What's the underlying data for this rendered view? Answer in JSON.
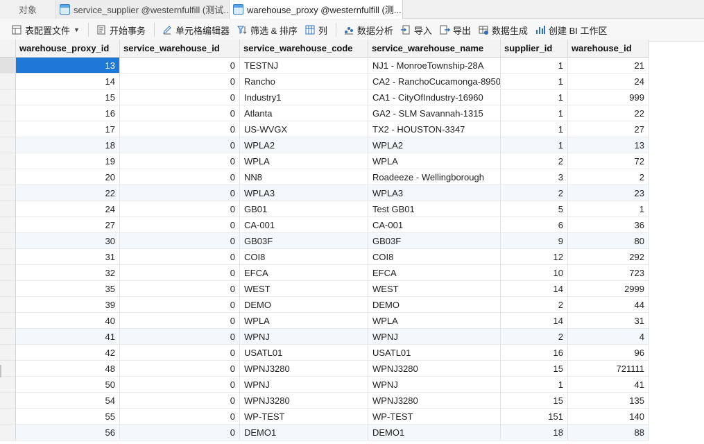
{
  "tabs": {
    "objects_label": "对象",
    "items": [
      {
        "label": "service_supplier @westernfulfill (测试..."
      },
      {
        "label": "warehouse_proxy @westernfulfill (测..."
      }
    ]
  },
  "toolbar": {
    "items": [
      {
        "label": "表配置文件",
        "icon": "table-config-icon"
      },
      {
        "label": "开始事务",
        "icon": "transaction-icon"
      },
      {
        "label": "单元格编辑器",
        "icon": "pencil-icon"
      },
      {
        "label": "筛选 & 排序",
        "icon": "filter-sort-icon"
      },
      {
        "label": "列",
        "icon": "columns-icon"
      },
      {
        "label": "数据分析",
        "icon": "data-analysis-icon"
      },
      {
        "label": "导入",
        "icon": "import-icon"
      },
      {
        "label": "导出",
        "icon": "export-icon"
      },
      {
        "label": "数据生成",
        "icon": "data-generate-icon"
      },
      {
        "label": "创建 BI 工作区",
        "icon": "bi-workspace-icon"
      }
    ]
  },
  "grid": {
    "columns": [
      "warehouse_proxy_id",
      "service_warehouse_id",
      "service_warehouse_code",
      "service_warehouse_name",
      "supplier_id",
      "warehouse_id"
    ],
    "rows": [
      [
        "13",
        "0",
        "TESTNJ",
        "NJ1 - MonroeTownship-28A",
        "1",
        "21"
      ],
      [
        "14",
        "0",
        "Rancho",
        "CA2 - RanchoCucamonga-8950",
        "1",
        "24"
      ],
      [
        "15",
        "0",
        "Industry1",
        "CA1 - CityOfIndustry-16960",
        "1",
        "999"
      ],
      [
        "16",
        "0",
        "Atlanta",
        "GA2 - SLM Savannah-1315",
        "1",
        "22"
      ],
      [
        "17",
        "0",
        "US-WVGX",
        "TX2 - HOUSTON-3347",
        "1",
        "27"
      ],
      [
        "18",
        "0",
        "WPLA2",
        "WPLA2",
        "1",
        "13"
      ],
      [
        "19",
        "0",
        "WPLA",
        "WPLA",
        "2",
        "72"
      ],
      [
        "20",
        "0",
        "NN8",
        "Roadeeze - Wellingborough",
        "3",
        "2"
      ],
      [
        "22",
        "0",
        "WPLA3",
        "WPLA3",
        "2",
        "23"
      ],
      [
        "24",
        "0",
        "GB01",
        "Test GB01",
        "5",
        "1"
      ],
      [
        "27",
        "0",
        "CA-001",
        "CA-001",
        "6",
        "36"
      ],
      [
        "30",
        "0",
        "GB03F",
        "GB03F",
        "9",
        "80"
      ],
      [
        "31",
        "0",
        "COI8",
        "COI8",
        "12",
        "292"
      ],
      [
        "32",
        "0",
        "EFCA",
        "EFCA",
        "10",
        "723"
      ],
      [
        "35",
        "0",
        "WEST",
        "WEST",
        "14",
        "2999"
      ],
      [
        "39",
        "0",
        "DEMO",
        "DEMO",
        "2",
        "44"
      ],
      [
        "40",
        "0",
        "WPLA",
        "WPLA",
        "14",
        "31"
      ],
      [
        "41",
        "0",
        "WPNJ",
        "WPNJ",
        "2",
        "4"
      ],
      [
        "42",
        "0",
        "USATL01",
        "USATL01",
        "16",
        "96"
      ],
      [
        "48",
        "0",
        "WPNJ3280",
        "WPNJ3280",
        "15",
        "721111"
      ],
      [
        "50",
        "0",
        "WPNJ",
        "WPNJ",
        "1",
        "41"
      ],
      [
        "54",
        "0",
        "WPNJ3280",
        "WPNJ3280",
        "15",
        "135"
      ],
      [
        "55",
        "0",
        "WP-TEST",
        "WP-TEST",
        "151",
        "140"
      ],
      [
        "56",
        "0",
        "DEMO1",
        "DEMO1",
        "18",
        "88"
      ]
    ]
  },
  "colors": {
    "selection": "#1e78d7",
    "header_bg": "#f3f3f3",
    "alt_row": "#f4f8fd"
  }
}
